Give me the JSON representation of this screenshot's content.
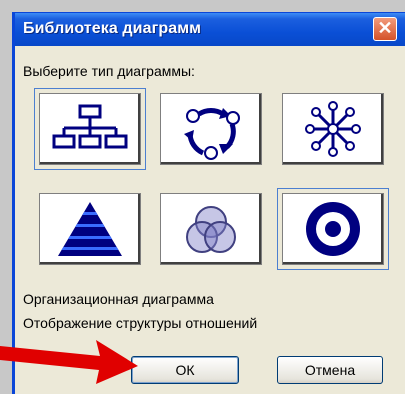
{
  "dialog": {
    "title": "Библиотека диаграмм",
    "close_glyph": "✕",
    "prompt": "Выберите тип диаграммы:",
    "diagram_types": [
      {
        "icon": "org-chart-icon",
        "selected": true
      },
      {
        "icon": "cycle-diagram-icon",
        "selected": false
      },
      {
        "icon": "radial-diagram-icon",
        "selected": false
      },
      {
        "icon": "pyramid-diagram-icon",
        "selected": false
      },
      {
        "icon": "venn-diagram-icon",
        "selected": false
      },
      {
        "icon": "target-diagram-icon",
        "selected": false
      }
    ],
    "description_title": "Организационная диаграмма",
    "description_text": "Отображение структуры отношений",
    "ok_label": "ОК",
    "cancel_label": "Отмена"
  },
  "colors": {
    "title_blue": "#0a4fd6",
    "diagram_navy": "#000080",
    "dialog_bg": "#ece9d8",
    "arrow_red": "#e00000"
  }
}
